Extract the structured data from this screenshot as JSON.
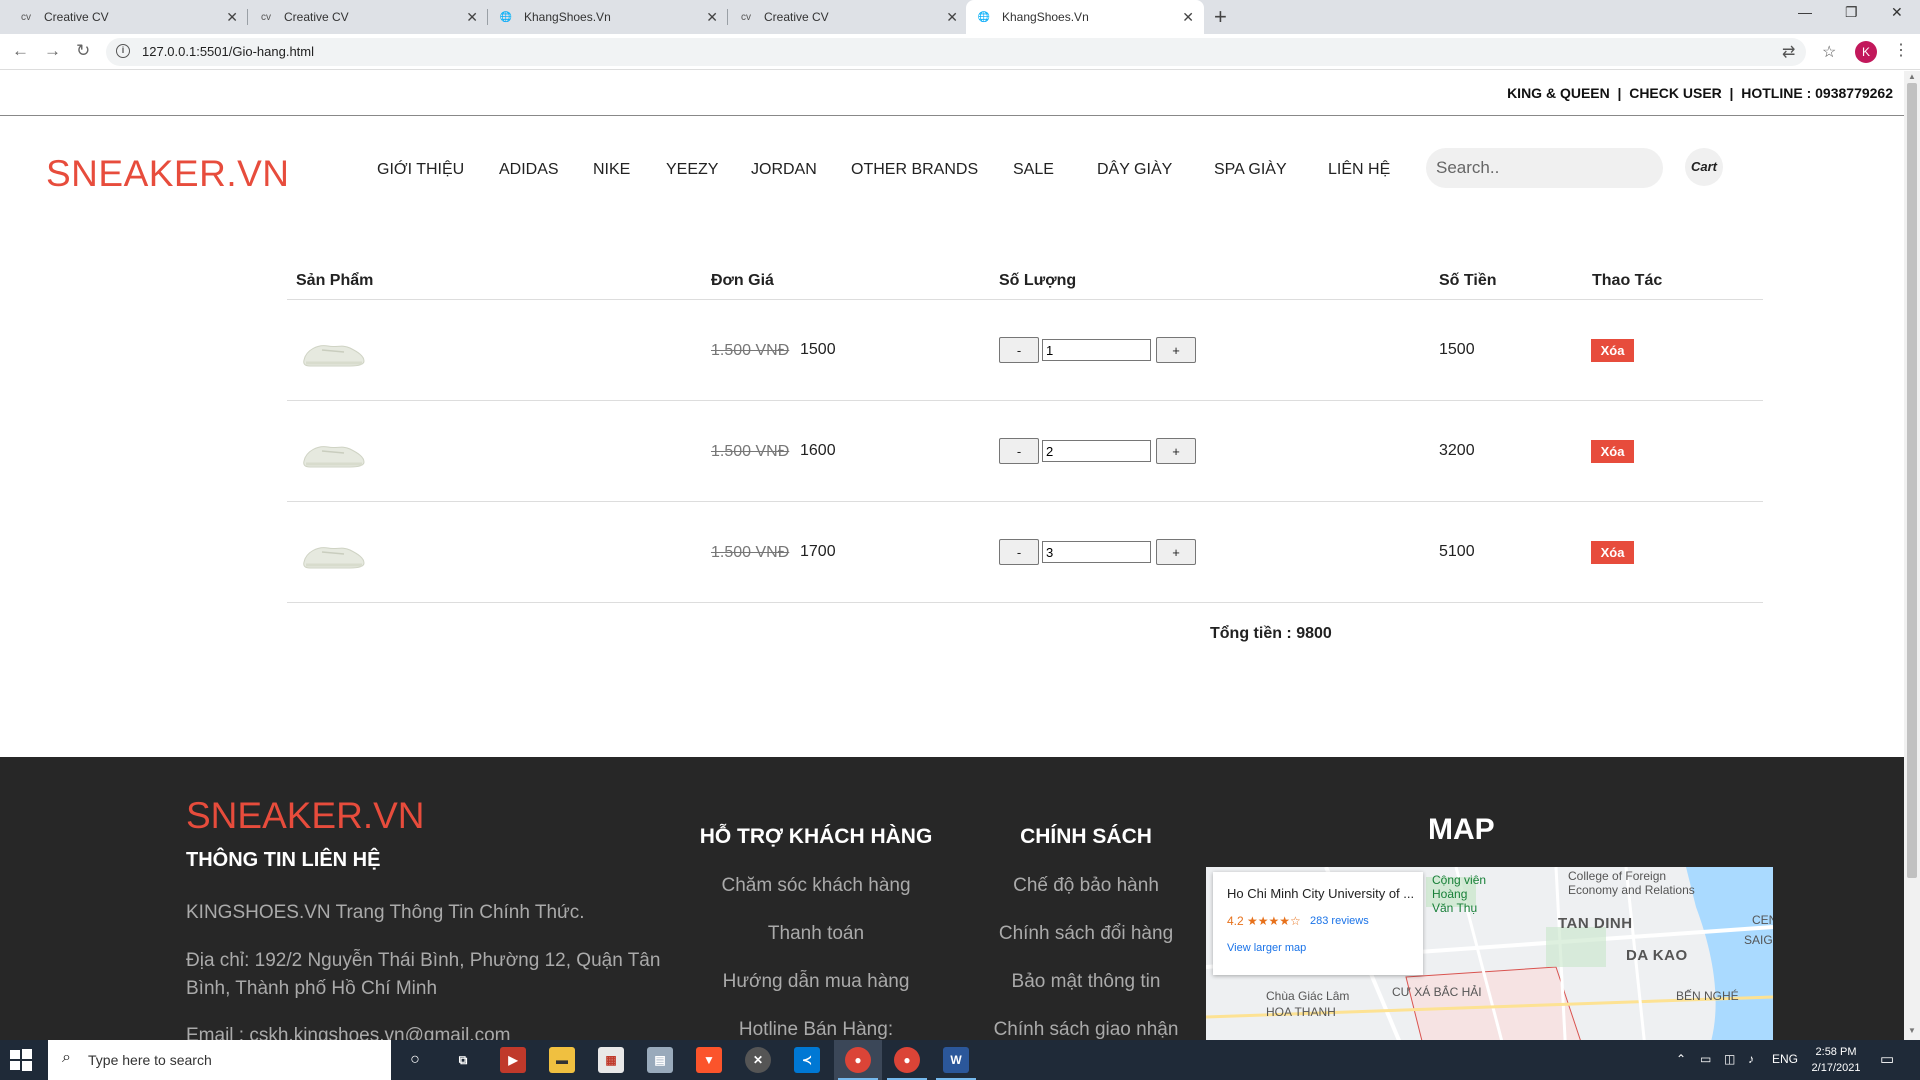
{
  "browser": {
    "tabs": [
      {
        "favicon": "cv",
        "title": "Creative CV"
      },
      {
        "favicon": "cv",
        "title": "Creative CV"
      },
      {
        "favicon": "globe",
        "title": "KhangShoes.Vn"
      },
      {
        "favicon": "cv",
        "title": "Creative CV"
      },
      {
        "favicon": "globe",
        "title": "KhangShoes.Vn"
      }
    ],
    "url": "127.0.0.1:5501/Gio-hang.html",
    "profile_initial": "K"
  },
  "site": {
    "topinfo": "KING & QUEEN  |  CHECK USER  |  HOTLINE : 0938779262",
    "logo": "SNEAKER.VN",
    "menu": [
      "GIỚI THIỆU",
      "ADIDAS",
      "NIKE",
      "YEEZY",
      "JORDAN",
      "OTHER BRANDS",
      "SALE",
      "DÂY GIÀY",
      "SPA GIÀY",
      "LIÊN HỆ"
    ],
    "search_placeholder": "Search..",
    "cart_label": "Cart"
  },
  "cart": {
    "headers": {
      "product": "Sản Phẩm",
      "unit_price": "Đơn Giá",
      "quantity": "Số Lượng",
      "amount": "Số Tiền",
      "action": "Thao Tác"
    },
    "items": [
      {
        "old_price": "1.500 VNĐ",
        "price": "1500",
        "minus": "-",
        "qty": "1",
        "plus": "+",
        "total": "1500",
        "delete": "Xóa"
      },
      {
        "old_price": "1.500 VNĐ",
        "price": "1600",
        "minus": "-",
        "qty": "2",
        "plus": "+",
        "total": "3200",
        "delete": "Xóa"
      },
      {
        "old_price": "1.500 VNĐ",
        "price": "1700",
        "minus": "-",
        "qty": "3",
        "plus": "+",
        "total": "5100",
        "delete": "Xóa"
      }
    ],
    "grand_total": "Tổng tiền : 9800"
  },
  "footer": {
    "logo": "SNEAKER.VN",
    "contact_title": "THÔNG TIN LIÊN HỆ",
    "intro": "KINGSHOES.VN Trang Thông Tin Chính Thức.",
    "address": "Địa chỉ: 192/2 Nguyễn Thái Bình, Phường 12, Quận Tân Bình, Thành phố Hồ Chí Minh",
    "email": "Email : cskh.kingshoes.vn@gmail.com",
    "support_title": "HỖ TRỢ KHÁCH HÀNG",
    "support_links": [
      "Chăm sóc khách hàng",
      "Thanh toán",
      "Hướng dẫn mua hàng",
      "Hotline Bán Hàng:"
    ],
    "policy_title": "CHÍNH SÁCH",
    "policy_links": [
      "Chế độ bảo hành",
      "Chính sách đổi hàng",
      "Bảo mật thông tin",
      "Chính sách giao nhận"
    ],
    "map_title": "MAP",
    "map": {
      "place_name": "Ho Chi Minh City University of ...",
      "rating": "4.2 ★★★★☆",
      "reviews": "283 reviews",
      "view_larger": "View larger map",
      "labels": [
        "Cộng viên",
        "Hoàng",
        "Văn Thụ",
        "College of Foreign",
        "Economy and Relations",
        "TAN DINH",
        "DA KAO",
        "Chùa Giác Lâm",
        "CƯ XÁ BẮC HẢI",
        "HOA THANH",
        "BẾN NGHÉ",
        "SAIGO",
        "CEN"
      ]
    }
  },
  "taskbar": {
    "search_placeholder": "Type here to search",
    "lang": "ENG",
    "time": "2:58 PM",
    "date": "2/17/2021"
  },
  "colors": {
    "accent": "#e74c3c",
    "footer_bg": "#272727",
    "taskbar_bg": "#1f2a38"
  }
}
